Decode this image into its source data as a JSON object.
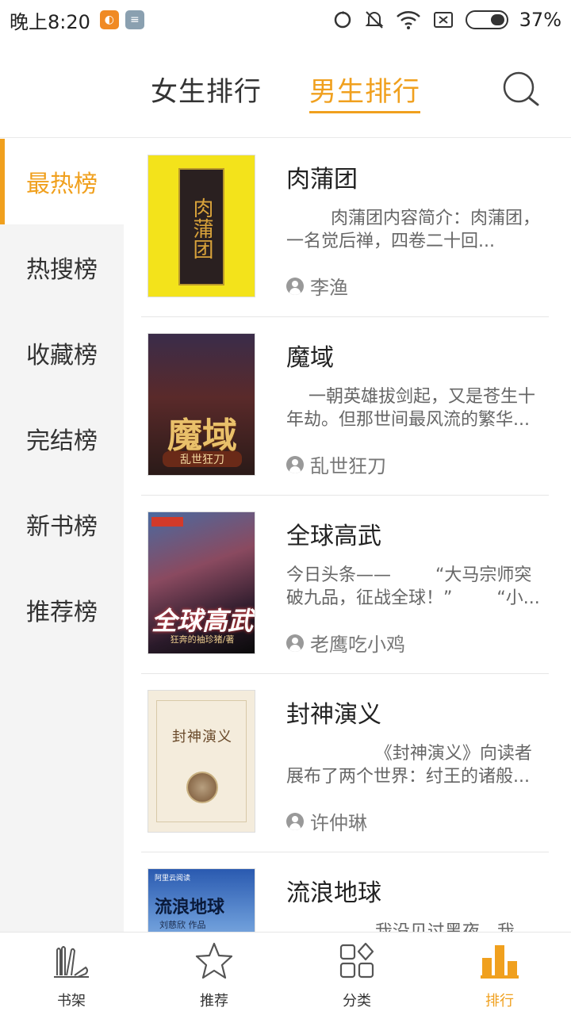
{
  "status_bar": {
    "time": "晚上8:20",
    "battery": "37%",
    "battery_level": 0.37
  },
  "tabs": {
    "female": "女生排行",
    "male": "男生排行",
    "active": "male"
  },
  "sidebar": {
    "items": [
      {
        "label": "最热榜",
        "active": true
      },
      {
        "label": "热搜榜",
        "active": false
      },
      {
        "label": "收藏榜",
        "active": false
      },
      {
        "label": "完结榜",
        "active": false
      },
      {
        "label": "新书榜",
        "active": false
      },
      {
        "label": "推荐榜",
        "active": false
      }
    ]
  },
  "books": [
    {
      "title": "肉蒲团",
      "desc": "        肉蒲团内容简介：肉蒲团，一名觉后禅，四卷二十回...",
      "author": "李渔",
      "cover_text": "肉蒲团"
    },
    {
      "title": "魔域",
      "desc": "    一朝英雄拔剑起，又是苍生十年劫。但那世间最风流的繁华...",
      "author": "乱世狂刀",
      "cover_title": "魔域",
      "cover_sub": "乱世狂刀"
    },
    {
      "title": "全球高武",
      "desc": "今日头条——        “大马宗师突破九品，征战全球！”        “小...",
      "author": "老鹰吃小鸡",
      "cover_title": "全球高武",
      "cover_sub": "狂奔的袖珍猪/著"
    },
    {
      "title": "封神演义",
      "desc": "                《封神演义》向读者展布了两个世界：纣王的诸般...",
      "author": "许仲琳",
      "cover_title": "封神演义"
    },
    {
      "title": "流浪地球",
      "desc": "                我没见过黑夜，我没...",
      "author": "",
      "cover_title": "流浪地球",
      "cover_sub": "刘慈欣 作品",
      "cover_top": "阿里云阅读"
    }
  ],
  "bottom_nav": {
    "items": [
      {
        "label": "书架",
        "icon": "bookshelf-icon"
      },
      {
        "label": "推荐",
        "icon": "star-icon"
      },
      {
        "label": "分类",
        "icon": "category-icon"
      },
      {
        "label": "排行",
        "icon": "ranking-icon",
        "active": true
      }
    ]
  },
  "colors": {
    "accent": "#f0a01e"
  }
}
